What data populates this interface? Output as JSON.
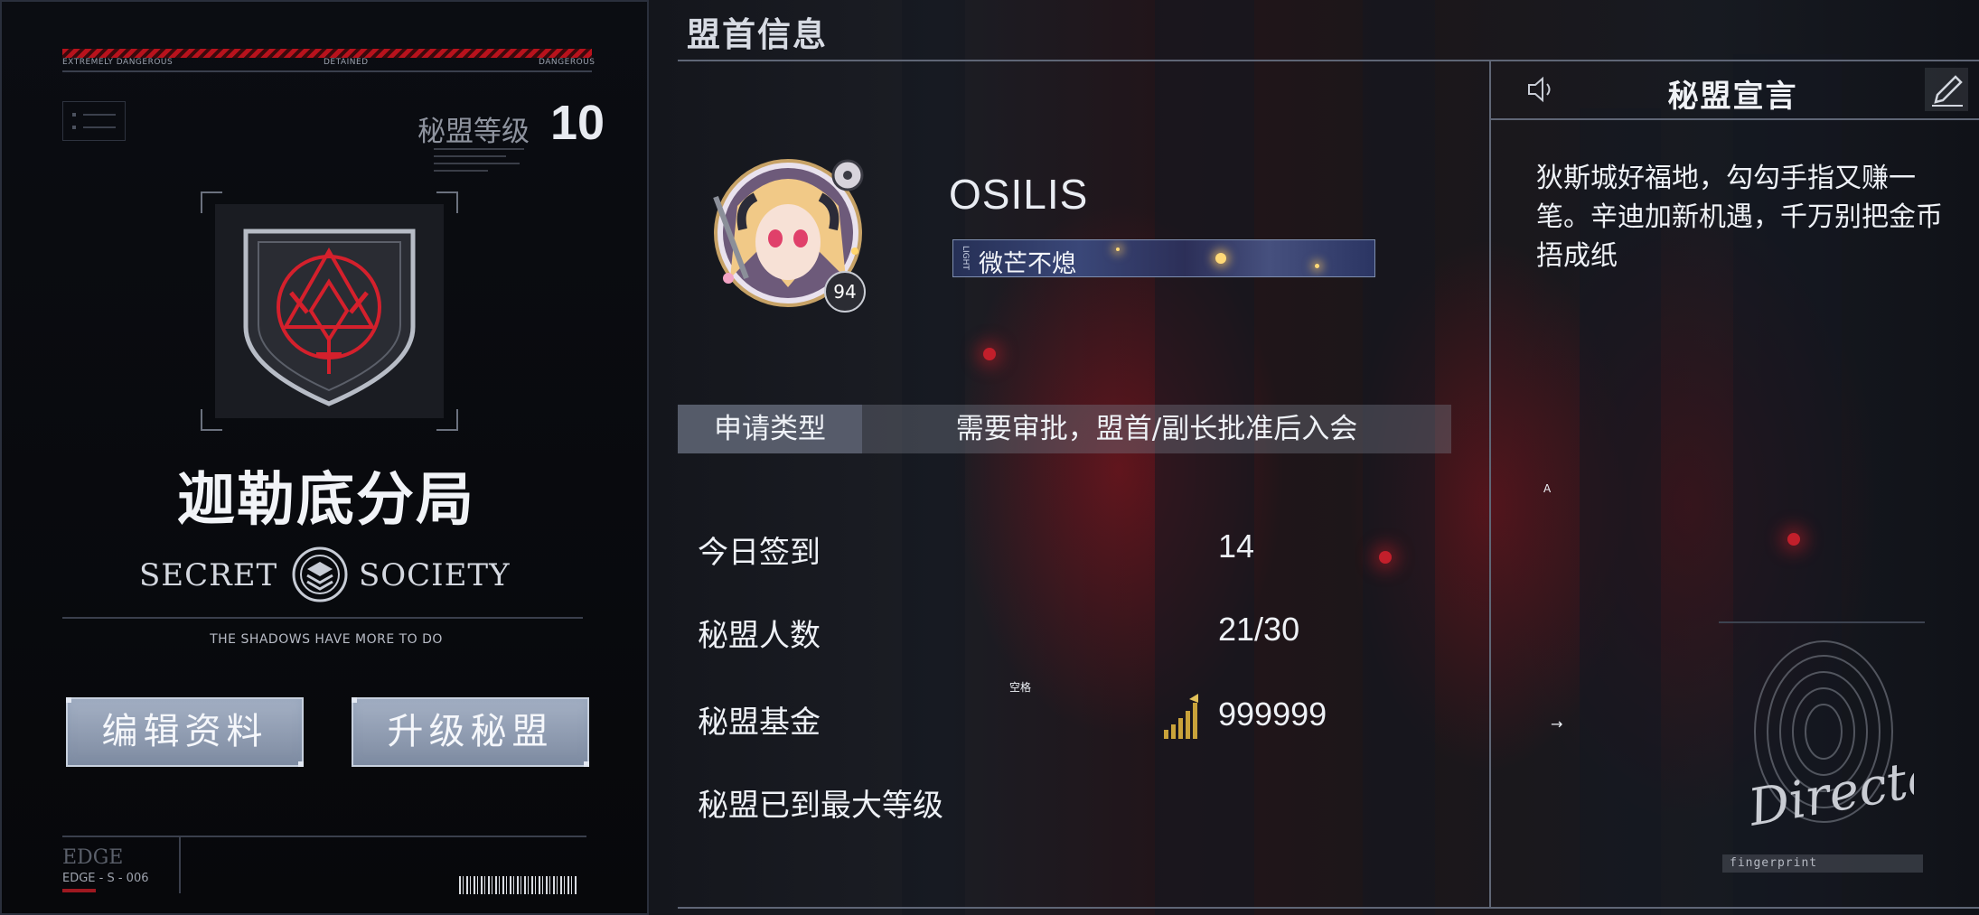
{
  "left_card": {
    "warning_labels": [
      "EXTREMELY DANGEROUS",
      "DETAINED",
      "DANGEROUS"
    ],
    "level_label": "秘盟等级",
    "level_value": "10",
    "guild_name": "迦勒底分局",
    "secret_left": "SECRET",
    "secret_right": "SOCIETY",
    "tagline": "THE SHADOWS HAVE MORE TO DO",
    "edit_button": "编辑资料",
    "upgrade_button": "升级秘盟",
    "edge_logo": "EDGE",
    "edge_code": "EDGE - S - 006"
  },
  "main": {
    "title": "盟首信息",
    "player_name": "OSILIS",
    "player_level": "94",
    "player_title": "微芒不熄",
    "apply_label": "申请类型",
    "apply_value": "需要审批，盟首/副长批准后入会",
    "stats": [
      {
        "label": "今日签到",
        "value": "14"
      },
      {
        "label": "秘盟人数",
        "value": "21/30"
      },
      {
        "label": "秘盟基金",
        "value": "999999"
      }
    ],
    "max_level_note": "秘盟已到最大等级",
    "space_hint": "空格",
    "key_hint_a": "A",
    "key_hint_arrow": "→"
  },
  "declaration": {
    "title": "秘盟宣言",
    "text": "狄斯城好福地，勾勾手指又赚一笔。辛迪加新机遇，千万别把金币捂成纸",
    "signature": "Director",
    "fingerprint_label": "fingerprint"
  },
  "colors": {
    "accent_red": "#c21f2b",
    "button_blue": "#8e9ab0",
    "gold": "#c9a23a"
  },
  "icons": [
    "menu-icon",
    "guild-emblem-icon",
    "secret-society-emblem-icon",
    "speaker-icon",
    "edit-pen-icon",
    "fund-bars-icon",
    "fingerprint-icon"
  ]
}
